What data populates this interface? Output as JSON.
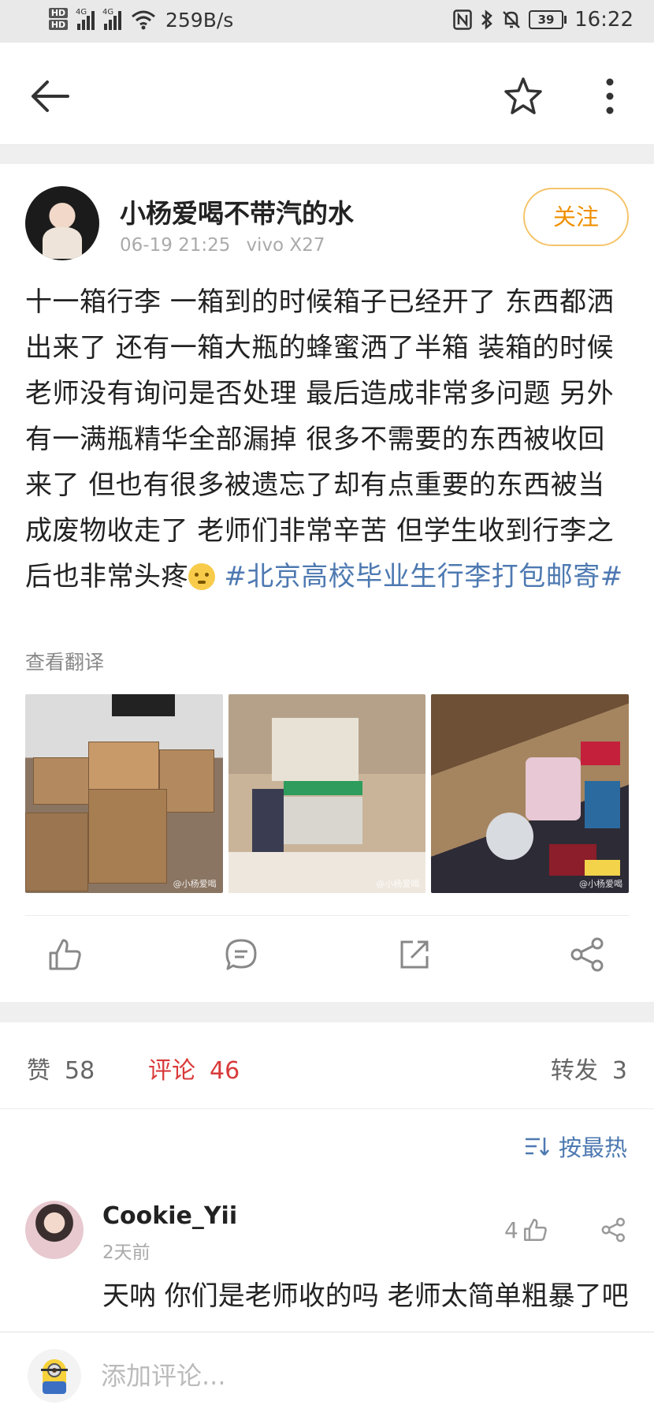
{
  "status_bar": {
    "hd1": "HD",
    "hd2": "HD",
    "net1": "4G",
    "net2": "4G",
    "speed": "259B/s",
    "battery": "39",
    "time": "16:22"
  },
  "post": {
    "author": "小杨爱喝不带汽的水",
    "date": "06-19 21:25",
    "device": "vivo X27",
    "follow_label": "关注",
    "text": "十一箱行李 一箱到的时候箱子已经开了 东西都洒出来了 还有一箱大瓶的蜂蜜洒了半箱 装箱的时候老师没有询问是否处理 最后造成非常多问题 另外有一满瓶精华全部漏掉 很多不需要的东西被收回来了 但也有很多被遗忘了却有点重要的东西被当成废物收走了 老师们非常辛苦 但学生收到行李之后也非常头疼",
    "topic": "#北京高校毕业生行李打包邮寄#",
    "translate": "查看翻译",
    "watermark": "@小杨爱喝"
  },
  "stats": {
    "like_label": "赞",
    "like_count": "58",
    "comment_label": "评论",
    "comment_count": "46",
    "repost_label": "转发",
    "repost_count": "3"
  },
  "sort_label": "按最热",
  "comments": [
    {
      "name": "Cookie_Yii",
      "time": "2天前",
      "likes": "4",
      "text": "天呐 你们是老师收的吗 老师太简单粗暴了吧"
    }
  ],
  "bottom_bar": {
    "placeholder": "添加评论..."
  },
  "icons": {
    "back": "arrow-left-icon",
    "favorite": "star-icon",
    "more": "more-vertical-icon",
    "like": "thumb-up-icon",
    "comment": "comment-icon",
    "repost": "repost-icon",
    "share": "share-icon",
    "sort": "sort-icon"
  }
}
